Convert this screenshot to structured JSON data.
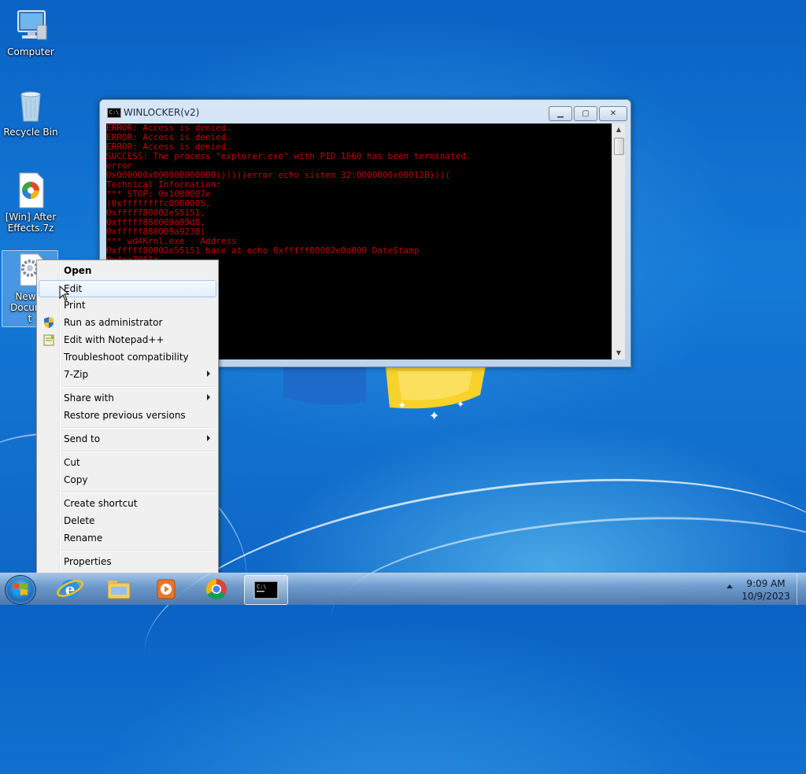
{
  "desktop": {
    "icons": [
      {
        "label": "Computer"
      },
      {
        "label": "Recycle Bin"
      },
      {
        "label": "[Win] After Effects.7z"
      },
      {
        "label": "New Text Document.txt",
        "visible_label": "New T\nDocume\nt"
      }
    ]
  },
  "console_window": {
    "title": "WINLOCKER(v2)",
    "icon_text": "C:\\",
    "lines": [
      "ERROR: Access is denied.",
      "ERROR: Access is denied.",
      "ERROR: Access is denied.",
      "SUCCESS: The process \"explorer.exe\" with PID 1660 has been terminated.",
      "error",
      "0x000000x000000000000))))))error echo sistem 32:0000000x00012B)))(",
      "Technical Information:",
      "*** STOP: 0x1000007e",
      "(0xffffffffc0000005,",
      "0xfffff80002e55151,",
      "0xfffff880009a99d8,",
      "0xfffff880009a9230)",
      "*** wd4Krnl.exe - Address",
      "0xfffff80002e55151 base at echo 0xfffff80002e0d000 DateStamp",
      "0x4ce7951a"
    ]
  },
  "context_menu": {
    "items": [
      {
        "label": "Open",
        "bold": true
      },
      {
        "label": "Edit",
        "highlighted": true
      },
      {
        "label": "Print"
      },
      {
        "label": "Run as administrator",
        "icon": "uac-shield-icon"
      },
      {
        "label": "Edit with Notepad++",
        "icon": "notepad-plus-plus-icon"
      },
      {
        "label": "Troubleshoot compatibility"
      },
      {
        "label": "7-Zip",
        "submenu": true
      },
      {
        "label": "Share with",
        "submenu": true
      },
      {
        "label": "Restore previous versions"
      },
      {
        "label": "Send to",
        "submenu": true
      },
      {
        "label": "Cut"
      },
      {
        "label": "Copy"
      },
      {
        "label": "Create shortcut"
      },
      {
        "label": "Delete"
      },
      {
        "label": "Rename"
      },
      {
        "label": "Properties"
      }
    ]
  },
  "taskbar": {
    "pinned": [
      "start-orb-icon",
      "internet-explorer-icon",
      "windows-explorer-icon",
      "media-player-icon",
      "chrome-icon",
      "command-prompt-icon"
    ],
    "clock": {
      "time": "9:09 AM",
      "date": "10/9/2023"
    }
  },
  "colors": {
    "console_text": "#c40000",
    "console_bg": "#000000",
    "desktop_blue": "#1479d6"
  }
}
